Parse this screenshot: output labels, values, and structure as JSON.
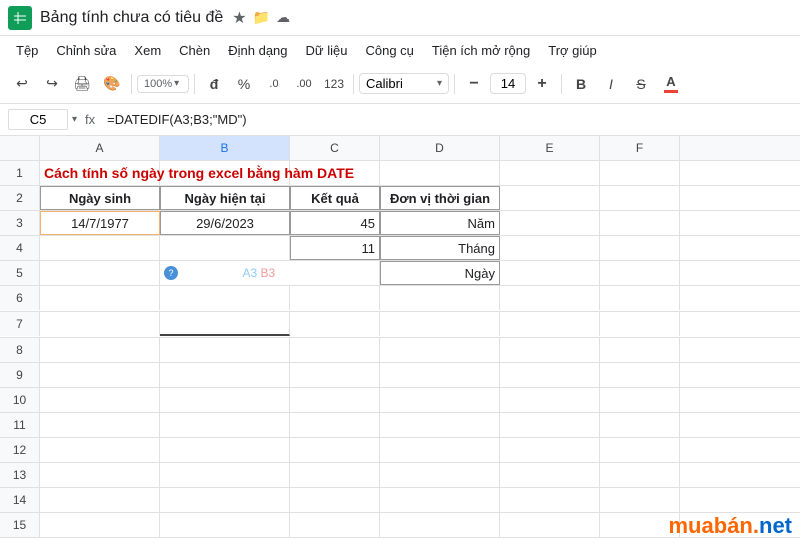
{
  "titleBar": {
    "docTitle": "Bảng tính chưa có tiêu đề",
    "starIcon": "★",
    "driveIcon": "📁",
    "cloudIcon": "☁"
  },
  "menuBar": {
    "items": [
      {
        "label": "Tệp"
      },
      {
        "label": "Chỉnh sửa"
      },
      {
        "label": "Xem"
      },
      {
        "label": "Chèn"
      },
      {
        "label": "Định dạng"
      },
      {
        "label": "Dữ liệu"
      },
      {
        "label": "Công cụ"
      },
      {
        "label": "Tiện ích mở rộng"
      },
      {
        "label": "Trợ giúp"
      }
    ]
  },
  "toolbar": {
    "undoLabel": "↩",
    "redoLabel": "↪",
    "printLabel": "🖨",
    "paintLabel": "🎨",
    "zoomValue": "100%",
    "zoomArrow": "▾",
    "formatBtnLabel": "đ",
    "percentLabel": "%",
    "decDeciLabel": ".0",
    "incDeciLabel": ".00",
    "numFormatLabel": "123",
    "fontName": "Calibri",
    "fontArrow": "▾",
    "minusLabel": "−",
    "fontSize": "14",
    "plusLabel": "+",
    "boldLabel": "B",
    "italicLabel": "I",
    "strikeLabel": "S̶",
    "colorLabel": "A"
  },
  "formulaBar": {
    "cellRef": "C5",
    "refArrow": "▾",
    "formulaIcon": "fx",
    "formulaValue": "=DATEDIF(A3;B3;\"MD\")"
  },
  "columns": [
    "A",
    "B",
    "C",
    "D",
    "E",
    "F"
  ],
  "rows": [
    {
      "num": 1,
      "cells": [
        "title",
        "",
        "",
        "",
        "",
        ""
      ]
    },
    {
      "num": 2,
      "cells": [
        "Ngày sinh",
        "Ngày hiện tại",
        "Kết quả",
        "Đơn vị thời gian",
        "",
        ""
      ]
    },
    {
      "num": 3,
      "cells": [
        "14/7/1977",
        "29/6/2023",
        "45",
        "Năm",
        "",
        ""
      ]
    },
    {
      "num": 4,
      "cells": [
        "",
        "",
        "11",
        "Tháng",
        "",
        ""
      ]
    },
    {
      "num": 5,
      "cells": [
        "",
        "",
        "formula",
        "Ngày",
        "",
        ""
      ]
    },
    {
      "num": 6,
      "cells": [
        "",
        "",
        "",
        "",
        "",
        ""
      ]
    },
    {
      "num": 7,
      "cells": [
        "",
        "",
        "",
        "",
        "",
        ""
      ]
    },
    {
      "num": 8,
      "cells": [
        "",
        "",
        "",
        "",
        "",
        ""
      ]
    },
    {
      "num": 9,
      "cells": [
        "",
        "",
        "",
        "",
        "",
        ""
      ]
    },
    {
      "num": 10,
      "cells": [
        "",
        "",
        "",
        "",
        "",
        ""
      ]
    },
    {
      "num": 11,
      "cells": [
        "",
        "",
        "",
        "",
        "",
        ""
      ]
    },
    {
      "num": 12,
      "cells": [
        "",
        "",
        "",
        "",
        "",
        ""
      ]
    },
    {
      "num": 13,
      "cells": [
        "",
        "",
        "",
        "",
        "",
        ""
      ]
    },
    {
      "num": 14,
      "cells": [
        "",
        "",
        "",
        "",
        "",
        ""
      ]
    },
    {
      "num": 15,
      "cells": [
        "",
        "",
        "",
        "",
        "",
        ""
      ]
    }
  ],
  "titleRowText": "Cách tính số ngày trong excel bằng hàm DATE",
  "header2": {
    "a": "Ngày sinh",
    "b": "Ngày hiện tại",
    "c": "Kết quả",
    "d": "Đơn vị thời gian"
  },
  "row3": {
    "a": "14/7/1977",
    "b": "29/6/2023",
    "c": "45",
    "d": "Năm"
  },
  "row4": {
    "c": "11",
    "d": "Tháng"
  },
  "row5": {
    "formula": "=DATEDIF(A3;B3;\"MD\")",
    "d": "Ngày"
  },
  "formula": {
    "prefix": "=DATEDIF(",
    "ref1": "A3",
    "sep1": ";",
    "ref2": "B3",
    "sep2": ";\"MD\")"
  },
  "watermark": {
    "text1": "mua",
    "text2": "bán",
    "dot": ".",
    "net": "net"
  }
}
